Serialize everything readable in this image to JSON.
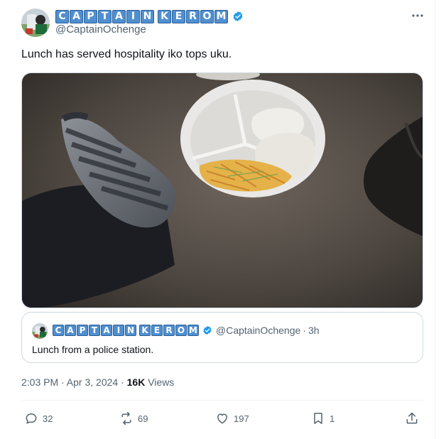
{
  "author": {
    "display_name_letters": [
      "C",
      "A",
      "P",
      "T",
      "A",
      "I",
      "N",
      " ",
      "K",
      "E",
      "R",
      "O",
      "M"
    ],
    "handle": "@CaptainOchenge",
    "verified": true
  },
  "tweet": {
    "text": "Lunch has served hospitality iko tops uku."
  },
  "quote": {
    "display_name_letters": [
      "C",
      "A",
      "P",
      "T",
      "A",
      "I",
      "N",
      " ",
      "K",
      "E",
      "R",
      "O",
      "M"
    ],
    "handle": "@CaptainOchenge",
    "age": "3h",
    "text": "Lunch from a police station."
  },
  "meta": {
    "time": "2:03 PM · Apr 3, 2024 · ",
    "views_count": "16K",
    "views_label": " Views"
  },
  "actions": {
    "replies": "32",
    "reposts": "69",
    "likes": "197",
    "bookmarks": "1"
  },
  "colors": {
    "text_primary": "#0f1419",
    "text_secondary": "#536471",
    "verified": "#1d9bf0",
    "border": "#cfd9de",
    "tile": "#4f8fd0"
  },
  "icons": {
    "more": "more-dots-icon",
    "verified": "verified-badge-icon",
    "reply": "reply-icon",
    "repost": "repost-icon",
    "like": "heart-icon",
    "bookmark": "bookmark-icon",
    "share": "share-icon"
  }
}
